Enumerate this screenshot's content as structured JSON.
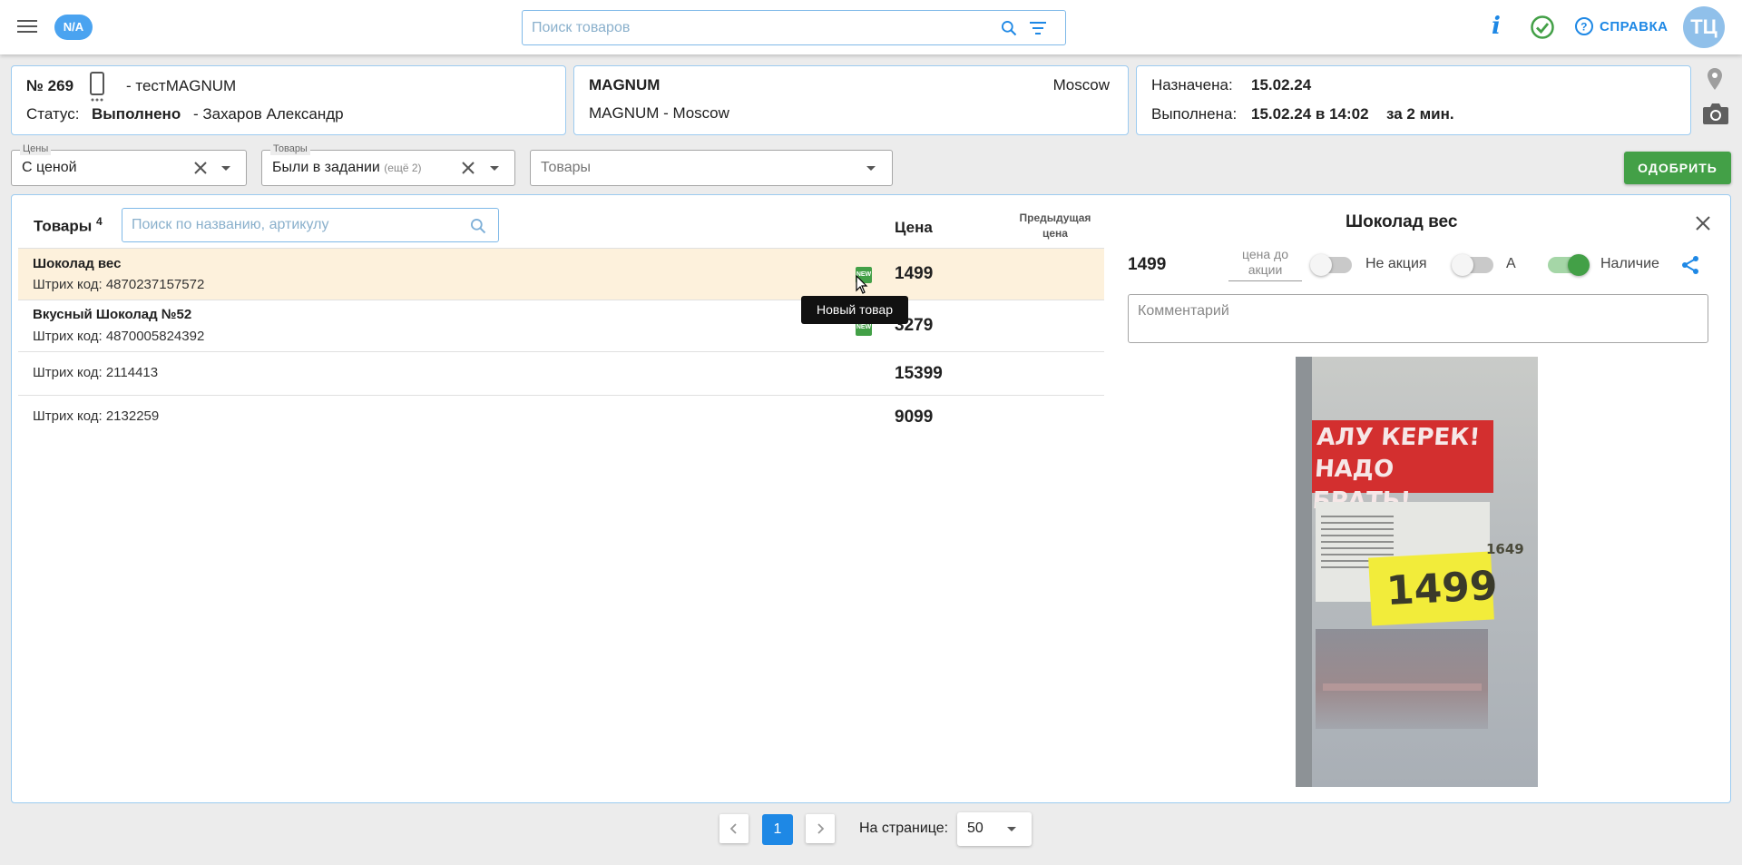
{
  "header": {
    "badge": "N/A",
    "search_placeholder": "Поиск товаров",
    "info_label": "i",
    "help_label": "СПРАВКА",
    "avatar_initials": "ТЦ"
  },
  "task": {
    "number": "№ 269",
    "name": "- тестMAGNUM",
    "status_label": "Статус:",
    "status_value": "Выполнено",
    "assignee": "- Захаров Александр"
  },
  "store": {
    "name": "MAGNUM",
    "city": "Moscow",
    "full": "MAGNUM - Moscow"
  },
  "dates": {
    "assigned_label": "Назначена:",
    "assigned_value": "15.02.24",
    "done_label": "Выполнена:",
    "done_value": "15.02.24 в 14:02",
    "duration": "за 2 мин."
  },
  "filters": {
    "prices": {
      "label": "Цены",
      "value": "С ценой"
    },
    "goods": {
      "label": "Товары",
      "value": "Были в задании",
      "extra": "(ещё 2)"
    },
    "goods_select_placeholder": "Товары",
    "approve_label": "ОДОБРИТЬ"
  },
  "list": {
    "title": "Товары",
    "count": "4",
    "search_placeholder": "Поиск по названию, артикулу",
    "col_price": "Цена",
    "col_prev_price": "Предыдущая цена",
    "rows": [
      {
        "name": "Шоколад вес",
        "code": "Штрих код: 4870237157572",
        "price": "1499",
        "is_new": true,
        "selected": true
      },
      {
        "name": "Вкусный Шоколад №52",
        "code": "Штрих код: 4870005824392",
        "price": "3279",
        "is_new": true,
        "selected": false
      },
      {
        "name": "",
        "code": "Штрих код: 2114413",
        "price": "15399",
        "is_new": false,
        "selected": false
      },
      {
        "name": "",
        "code": "Штрих код: 2132259",
        "price": "9099",
        "is_new": false,
        "selected": false
      }
    ],
    "new_badge": "NEW",
    "tooltip": "Новый товар"
  },
  "detail": {
    "title": "Шоколад вес",
    "price": "1499",
    "promo_price_label": "цена до акции",
    "toggles": [
      {
        "label": "Не акция",
        "on": false
      },
      {
        "label": "А",
        "on": false
      },
      {
        "label": "Наличие",
        "on": true
      }
    ],
    "comment_placeholder": "Комментарий",
    "photo": {
      "banner_text": "АЛУ КЕРЕК! НАДО БРАТЬ!",
      "tag_price": "1499",
      "tag_small_price": "1649"
    }
  },
  "pagination": {
    "current_page": "1",
    "per_page_label": "На странице:",
    "per_page_value": "50"
  },
  "colors": {
    "accent": "#1e88e5",
    "approve": "#43a047",
    "selected_row": "#fdf1dc"
  }
}
